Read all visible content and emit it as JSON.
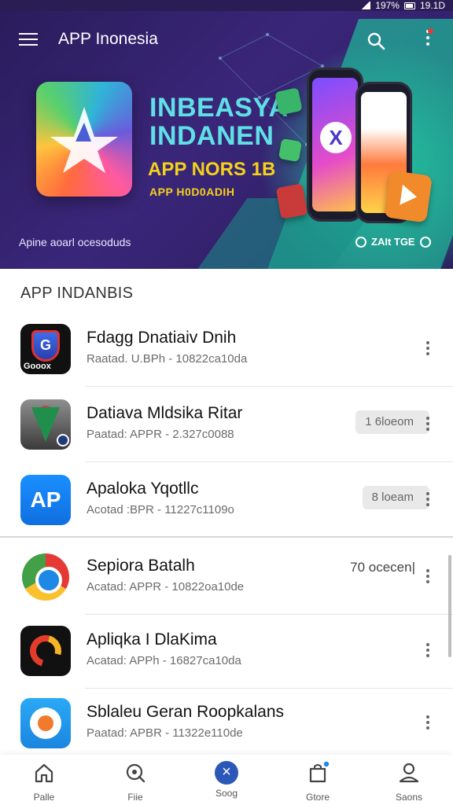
{
  "status_bar": {
    "battery": "197%",
    "time": "19.1D"
  },
  "header": {
    "title": "APP Inonesia",
    "banner": {
      "line1": "INBEASYA",
      "line2": "INDANEN",
      "line3": "APP NORS 1B",
      "line4": "APP H0D0ADIH",
      "caption": "Apine aoarl ocesoduds",
      "badge": "ZAIt TGE"
    }
  },
  "section": {
    "title": "APP INDANBIS"
  },
  "apps": [
    {
      "name": "Fdagg Dnatiaiv Dnih",
      "sub": "Raatad. U.BPh - 10822ca10da",
      "action": ""
    },
    {
      "name": "Datiava Mldsika Ritar",
      "sub": "Paatad: APPR - 2.327c0088",
      "action": "1 6loeom"
    },
    {
      "name": "Apaloka Yqotllc",
      "sub": "Acotad  :BPR - 11227c1109o",
      "action": "8 loeam"
    },
    {
      "name": "Sepiora Batalh",
      "sub": "Acatad: APPR - 10822oa10de",
      "action": "70 ocecen|"
    },
    {
      "name": "Apliqka I DlaKima",
      "sub": "Acatad: APPh - 16827ca10da",
      "action": ""
    },
    {
      "name": "Sblaleu Geran Roopkalans",
      "sub": "Paatad: APBR - 11322e110de",
      "action": ""
    }
  ],
  "bottom_nav": [
    {
      "label": "Palle",
      "icon": "home-icon"
    },
    {
      "label": "Fiie",
      "icon": "discover-icon"
    },
    {
      "label": "Soog",
      "icon": "app-center-icon"
    },
    {
      "label": "Gtore",
      "icon": "store-bag-icon"
    },
    {
      "label": "Saons",
      "icon": "profile-icon"
    }
  ],
  "colors": {
    "hero_bg": "#2a1c5c",
    "accent_teal": "#1fb99a",
    "hero_title": "#5ee0e6",
    "hero_yellow": "#f5d21a"
  }
}
